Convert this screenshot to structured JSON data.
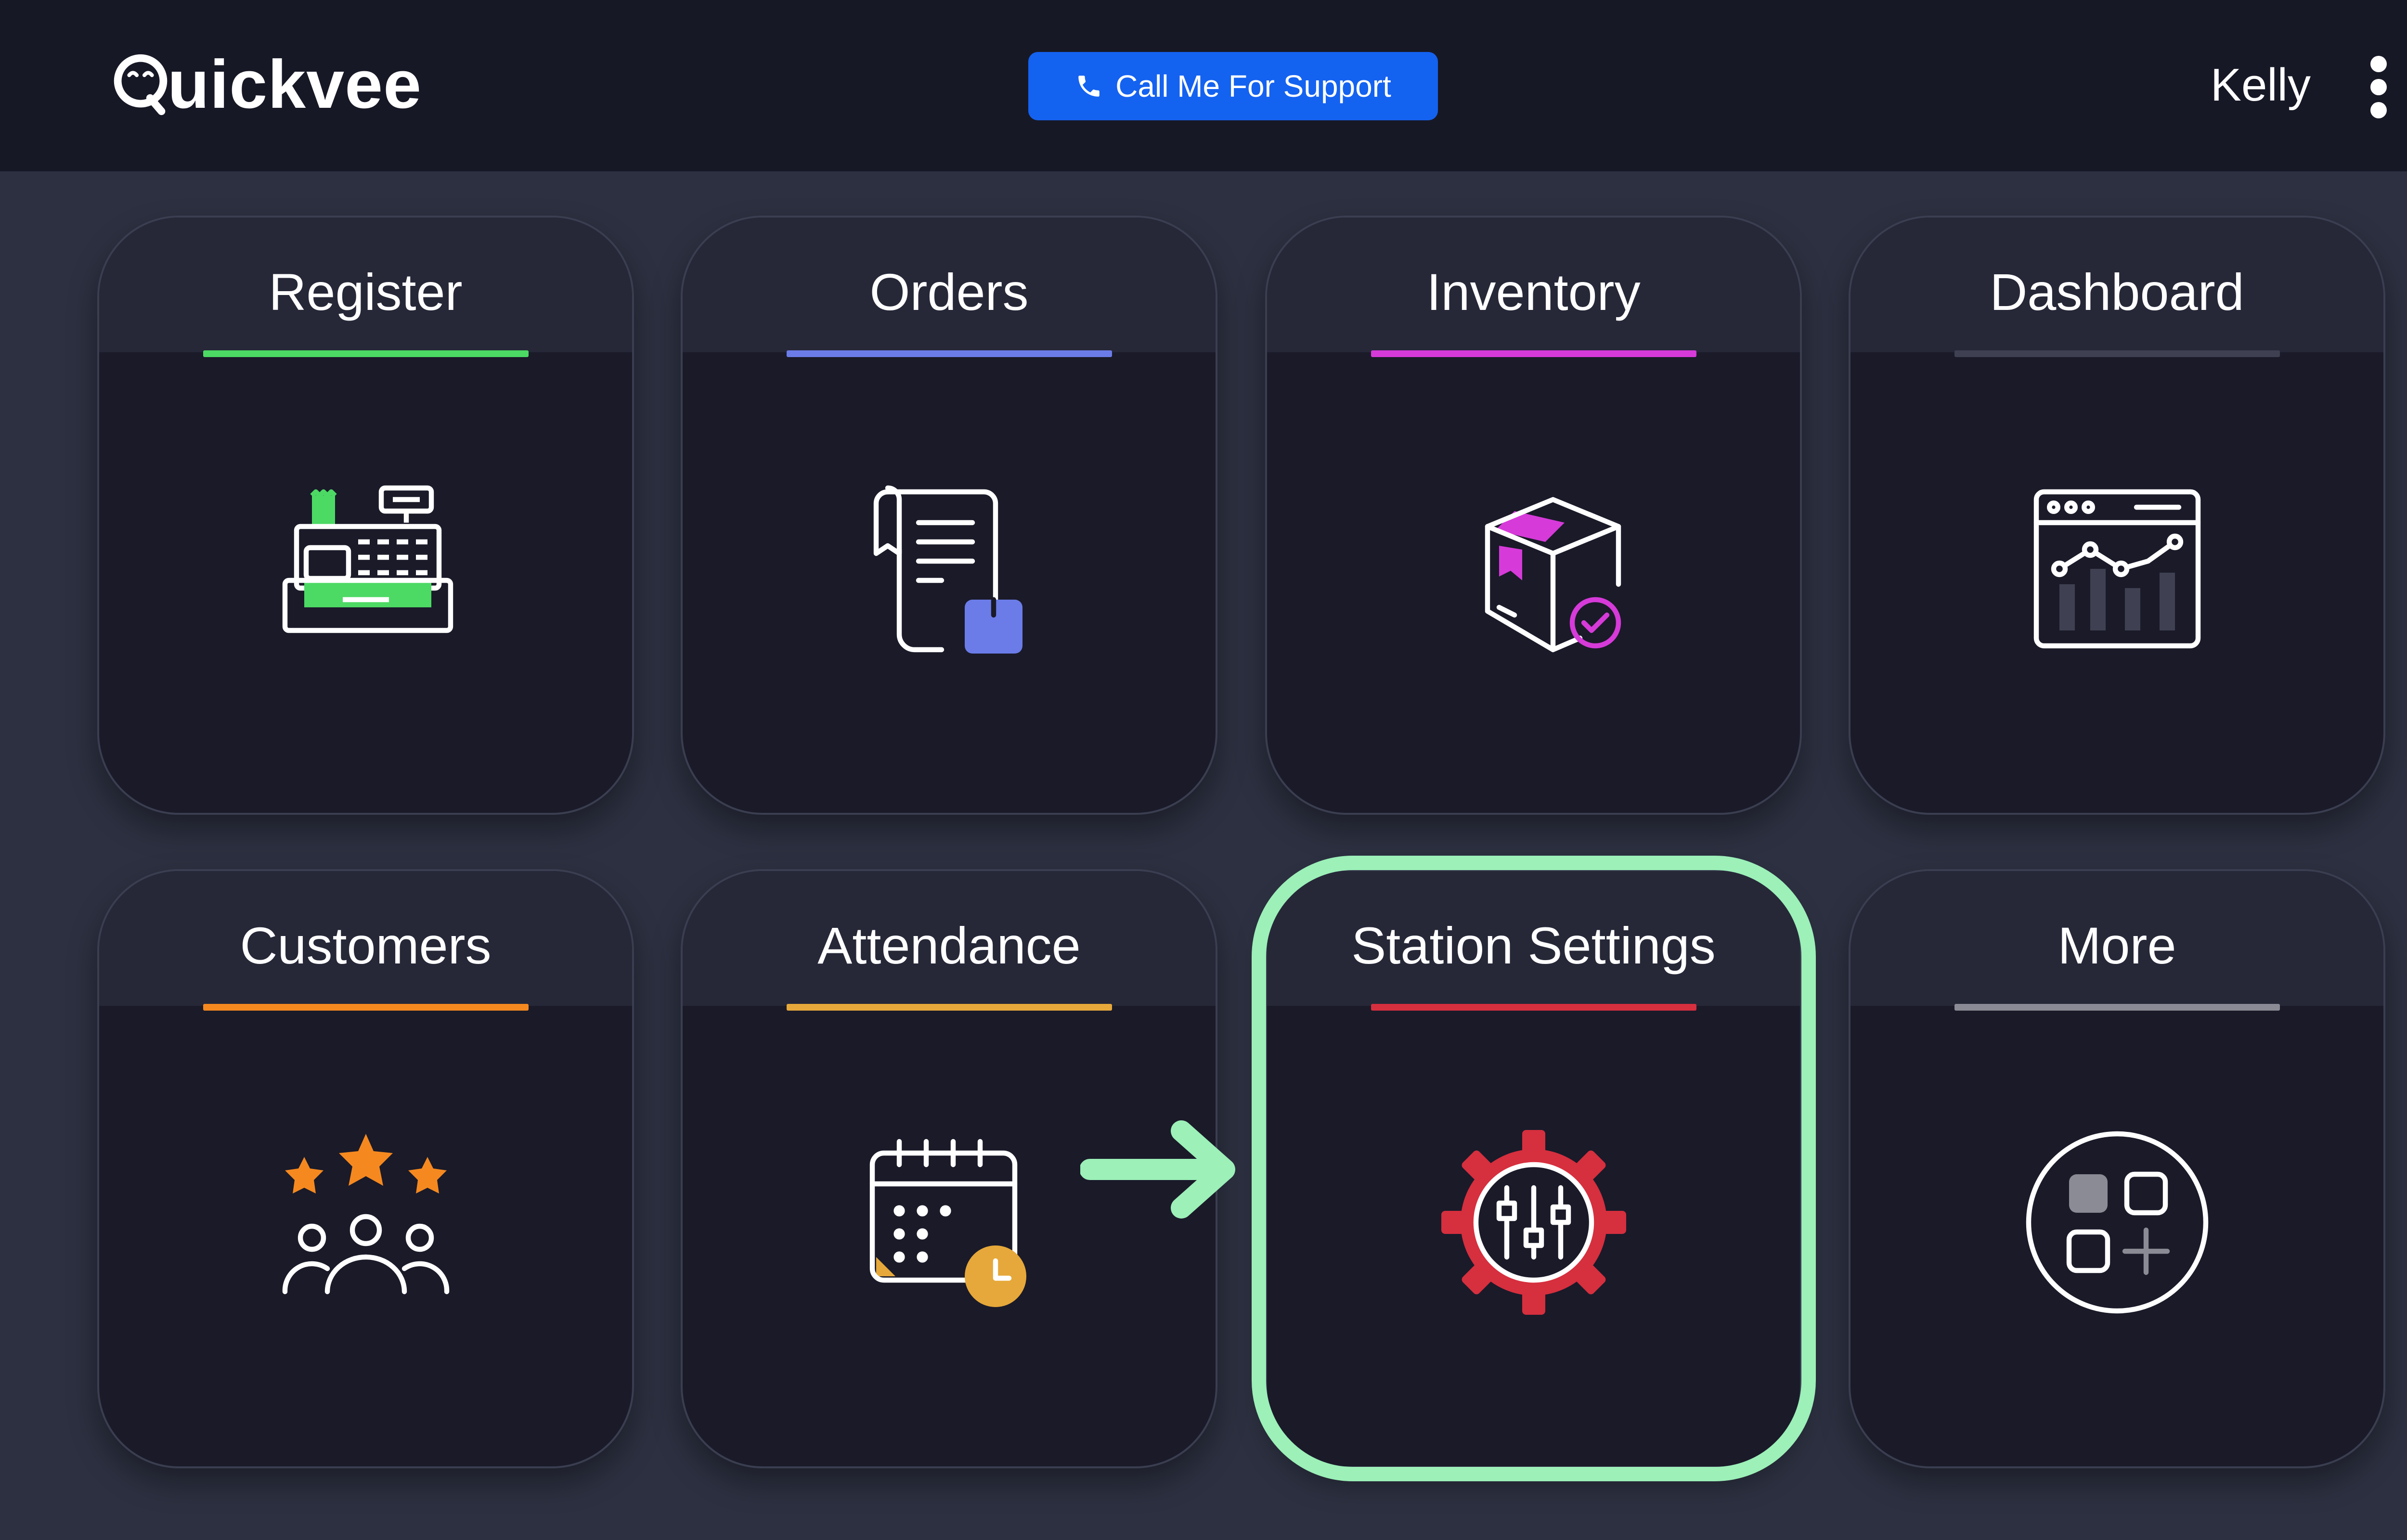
{
  "header": {
    "logo_text": "uickvee",
    "support_button": "Call Me For Support",
    "user_name": "Kelly"
  },
  "tiles": [
    {
      "label": "Register",
      "accent": "#4cd964",
      "icon": "cash-register-icon"
    },
    {
      "label": "Orders",
      "accent": "#6b7ce8",
      "icon": "receipt-icon"
    },
    {
      "label": "Inventory",
      "accent": "#d63ad9",
      "icon": "package-check-icon"
    },
    {
      "label": "Dashboard",
      "accent": "#3f4152",
      "icon": "analytics-dashboard-icon"
    },
    {
      "label": "Customers",
      "accent": "#f5891f",
      "icon": "customers-rating-icon"
    },
    {
      "label": "Attendance",
      "accent": "#e6a83a",
      "icon": "calendar-clock-icon"
    },
    {
      "label": "Station Settings",
      "accent": "#d62f3e",
      "icon": "settings-gear-sliders-icon"
    },
    {
      "label": "More",
      "accent": "#8a8b94",
      "icon": "more-apps-icon"
    }
  ],
  "colors": {
    "topbar": "#171826",
    "background": "#2c3040",
    "tile": "#1a1a29",
    "support_button": "#1462f0",
    "highlight": "#9cf0b8"
  }
}
